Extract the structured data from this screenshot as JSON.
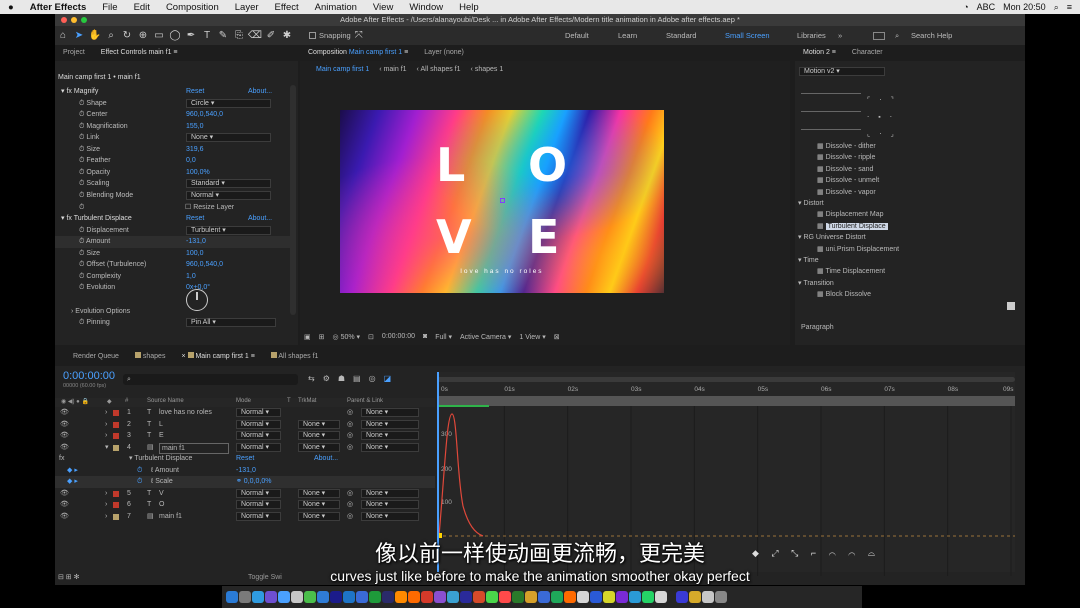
{
  "menubar": {
    "apple": "",
    "app": "After Effects",
    "items": [
      "File",
      "Edit",
      "Composition",
      "Layer",
      "Effect",
      "Animation",
      "View",
      "Window",
      "Help"
    ],
    "input_source": "ABC",
    "clock": "Mon 20:50"
  },
  "window": {
    "title": "Adobe After Effects - /Users/alanayoubi/Desk ... in Adobe After Effects/Modern title animation in Adobe after effects.aep *"
  },
  "toolbar": {
    "snapping": "Snapping",
    "workspaces": [
      "Default",
      "Learn",
      "Standard",
      "Small Screen",
      "Libraries"
    ],
    "search_help": "Search Help"
  },
  "project_panel": {
    "tabs": [
      "Project",
      "Effect Controls main f1"
    ],
    "header": "Main camp first 1 • main f1",
    "rows": [
      {
        "label": "Magnify",
        "value": "Reset",
        "extra": "About..."
      },
      {
        "label": "Shape",
        "value": "Circle"
      },
      {
        "label": "Center",
        "value": "960,0,540,0"
      },
      {
        "label": "Magnification",
        "value": "155,0"
      },
      {
        "label": "Link",
        "value": "None"
      },
      {
        "label": "Size",
        "value": "319,6"
      },
      {
        "label": "Feather",
        "value": "0,0"
      },
      {
        "label": "Opacity",
        "value": "100,0%"
      },
      {
        "label": "Scaling",
        "value": "Standard"
      },
      {
        "label": "Blending Mode",
        "value": "Normal"
      },
      {
        "label": "",
        "value": "Resize Layer"
      },
      {
        "label": "Turbulent Displace",
        "value": "Reset",
        "extra": "About..."
      },
      {
        "label": "Displacement",
        "value": "Turbulent"
      },
      {
        "label": "Amount",
        "value": "-131,0"
      },
      {
        "label": "Size",
        "value": "100,0"
      },
      {
        "label": "Offset (Turbulence)",
        "value": "960,0,540,0"
      },
      {
        "label": "Complexity",
        "value": "1,0"
      },
      {
        "label": "Evolution",
        "value": "0x+0,0°"
      },
      {
        "label": "Evolution Options",
        "value": ""
      },
      {
        "label": "Pinning",
        "value": "Pin All"
      }
    ]
  },
  "composition": {
    "tab": "Composition",
    "tab_name": "Main camp first 1",
    "layer_tab": "Layer (none)",
    "breadcrumbs": [
      "Main camp first 1",
      "main f1",
      "All shapes f1",
      "shapes 1"
    ],
    "letters": [
      "L",
      "O",
      "V",
      "E"
    ],
    "tagline": "love has no roles",
    "footer": {
      "zoom": "50%",
      "time": "0:00:00:00",
      "resolution": "Full",
      "camera": "Active Camera",
      "view": "1 View"
    }
  },
  "right_panel": {
    "tabs": [
      "Motion 2",
      "Character"
    ],
    "preset": "Motion v2",
    "effects": [
      {
        "label": "Dissolve - dither",
        "type": "item"
      },
      {
        "label": "Dissolve - ripple",
        "type": "item"
      },
      {
        "label": "Dissolve - sand",
        "type": "item"
      },
      {
        "label": "Dissolve - unmelt",
        "type": "item"
      },
      {
        "label": "Dissolve - vapor",
        "type": "item"
      },
      {
        "label": "Distort",
        "type": "group"
      },
      {
        "label": "Displacement Map",
        "type": "item"
      },
      {
        "label": "Turbulent Displace",
        "type": "item-selected"
      },
      {
        "label": "RG Universe Distort",
        "type": "group"
      },
      {
        "label": "uni.Prism Displacement",
        "type": "item"
      },
      {
        "label": "Time",
        "type": "group"
      },
      {
        "label": "Time Displacement",
        "type": "item"
      },
      {
        "label": "Transition",
        "type": "group"
      },
      {
        "label": "Block Dissolve",
        "type": "item"
      }
    ],
    "paragraph": "Paragraph"
  },
  "timeline": {
    "tabs": [
      "Render Queue",
      "shapes",
      "Main camp first 1",
      "All shapes f1"
    ],
    "timecode": "0:00:00:00",
    "fps": "00000 (60.00 fps)",
    "columns": [
      "#",
      "Source Name",
      "Mode",
      "T",
      "TrkMat",
      "Parent & Link"
    ],
    "ruler": [
      "0s",
      "01s",
      "02s",
      "03s",
      "04s",
      "05s",
      "06s",
      "07s",
      "08s",
      "09s"
    ],
    "graph_labels": [
      "300",
      "200",
      "100"
    ],
    "toggle": "Toggle Swi",
    "layers": [
      {
        "num": "1",
        "name": "love has no roles",
        "mode": "Normal",
        "trk": "",
        "parent": "None",
        "color": "#c0392b",
        "kind": "T"
      },
      {
        "num": "2",
        "name": "L",
        "mode": "Normal",
        "trk": "None",
        "parent": "None",
        "color": "#c0392b",
        "kind": "T"
      },
      {
        "num": "3",
        "name": "E",
        "mode": "Normal",
        "trk": "None",
        "parent": "None",
        "color": "#c0392b",
        "kind": "T"
      },
      {
        "num": "4",
        "name": "main f1",
        "mode": "Normal",
        "trk": "None",
        "parent": "None",
        "color": "#b7a26b",
        "kind": "comp"
      },
      {
        "num": "",
        "name": "Turbulent Displace",
        "mode": "Reset",
        "trk": "",
        "parent": "About...",
        "color": "",
        "kind": "fx"
      },
      {
        "num": "",
        "name": "Amount",
        "mode": "-131,0",
        "trk": "",
        "parent": "",
        "color": "",
        "kind": "prop"
      },
      {
        "num": "",
        "name": "Scale",
        "mode": "0,0,0,0%",
        "trk": "",
        "parent": "",
        "color": "",
        "kind": "prop"
      },
      {
        "num": "5",
        "name": "V",
        "mode": "Normal",
        "trk": "None",
        "parent": "None",
        "color": "#c0392b",
        "kind": "T"
      },
      {
        "num": "6",
        "name": "O",
        "mode": "Normal",
        "trk": "None",
        "parent": "None",
        "color": "#c0392b",
        "kind": "T"
      },
      {
        "num": "7",
        "name": "main f1",
        "mode": "Normal",
        "trk": "None",
        "parent": "None",
        "color": "#b7a26b",
        "kind": "comp"
      }
    ]
  },
  "subtitles": {
    "chinese": "像以前一样使动画更流畅，更完美",
    "english": "curves just like before to make the animation smoother okay perfect"
  },
  "colors": {
    "accent": "#4aa0ff",
    "graph_curve": "#e0483a",
    "playhead": "#4aa0ff"
  }
}
